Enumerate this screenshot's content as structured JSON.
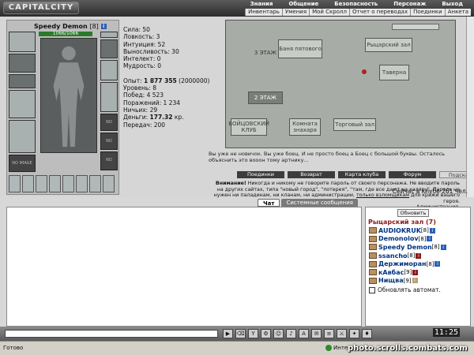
{
  "header": {
    "logo": "CAPITALCITY",
    "nav_top": [
      "Знания",
      "Общение",
      "Безопасность",
      "Персонаж",
      "Выход"
    ],
    "nav_sub": [
      "Инвентарь",
      "Умения",
      "Мой Скролл",
      "Отчет о переводах",
      "Поединки",
      "Анкета"
    ]
  },
  "character": {
    "name": "Speedy Demon",
    "level": "[8]",
    "hp": "1066/1066",
    "no_image": "NO IMAGE"
  },
  "stats": {
    "strength": "Сила: 50",
    "agility": "Ловкость: 3",
    "intuition": "Интуиция: 52",
    "endurance": "Выносливость: 30",
    "intellect": "Интелект: 0",
    "wisdom": "Мудрость: 0",
    "exp_label": "Опыт: ",
    "exp_value": "1 877 355",
    "exp_next": " (2000000)",
    "level": "Уровень: 8",
    "wins": "Побед: 4 523",
    "losses": "Поражений: 1 234",
    "draws": "Ничьих: 29",
    "money_label": "Деньги: ",
    "money_value": "177.32",
    "money_unit": " кр.",
    "transfers": "Передач: 200"
  },
  "map": {
    "floor3": "3 ЭТАЖ",
    "floor2": "2 ЭТАЖ",
    "bath": "Баня пятового",
    "knight_hall": "Рыцарский зал",
    "tavern": "Таверна",
    "fight_club": "БОЙЦОВСКИЙ КЛУБ",
    "beginners": "Комната знахаря",
    "trade_hall": "Торговый зал"
  },
  "notice": "Вы уже не новичок. Вы уже боец. И не просто боец а Боец с большой буквы. Осталось объяснить это вооон тому артнику...",
  "buttons": [
    "Поединки",
    "Возврат",
    "Карта клуба",
    "Форум",
    "Подсказка"
  ],
  "warning": {
    "bold": "Внимание!",
    "text": " Никогда и никому не говорите пароль от своего персонажа. Не вводите пароль на других сайтах, типа \"новый город\", \"лотерея\", \"там, где все дают на халяву\". Пароль не нужен ни паладинам, ни кланам, ни администрации,",
    "link": "только взломщикам",
    "tail": " для кражи вашего героя.",
    "sign": "Администрация."
  },
  "online": "Сейчас в клубе 261 чел.",
  "tabs": [
    "Чат",
    "Системные сообщения"
  ],
  "sidebar": {
    "refresh": "Обновить",
    "room": "Рыцарский зал (7)",
    "players": [
      {
        "name": "AUDIOKRUK",
        "level": "[8]",
        "color": "#2b5fb8"
      },
      {
        "name": "Demonolov",
        "level": "[8]",
        "color": "#2b5fb8"
      },
      {
        "name": "Speedy Demon",
        "level": "[8]",
        "color": "#2b5fb8"
      },
      {
        "name": "ssancho",
        "level": "[8]",
        "color": "#8b1a1a"
      },
      {
        "name": "Держиморан",
        "level": "[8]",
        "color": "#2b5fb8"
      },
      {
        "name": "кАвбас",
        "level": "[9]",
        "color": "#8b1a1a"
      },
      {
        "name": "Нищва",
        "level": "[9]",
        "color": "#b8a070"
      }
    ],
    "auto_refresh": "Обновлять автомат."
  },
  "clock": "11:25",
  "status": {
    "left": "Готово",
    "zone": "Интернет"
  },
  "watermark": "photo.scrolls.combats.com"
}
